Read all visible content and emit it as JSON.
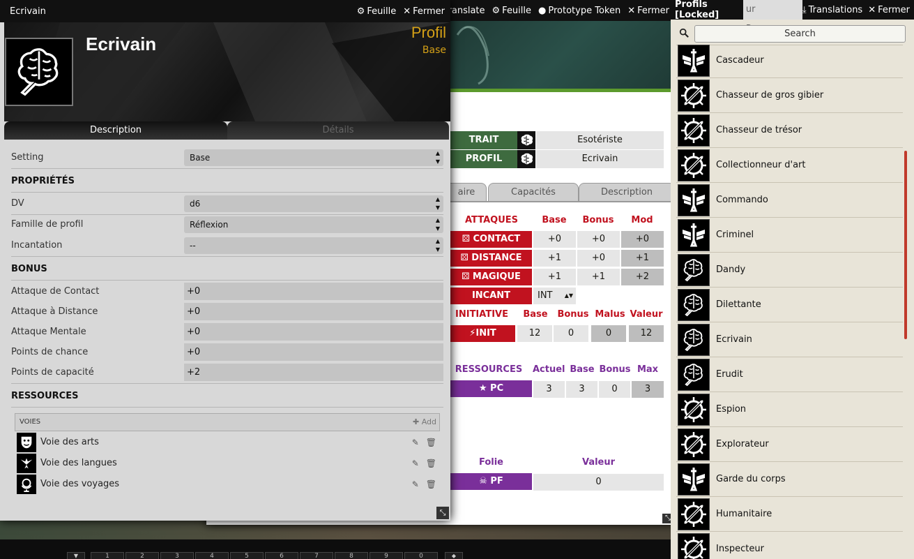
{
  "item_window": {
    "title": "Ecrivain",
    "sheet_label": "Feuille",
    "close_label": "Fermer",
    "name": "Ecrivain",
    "type_label": "Profil",
    "setting_value": "Base",
    "tabs": [
      "Description",
      "Détails"
    ],
    "fields": {
      "setting": {
        "label": "Setting",
        "value": "Base"
      },
      "proprietes_heading": "PROPRIÉTÉS",
      "dv": {
        "label": "DV",
        "value": "d6"
      },
      "famille": {
        "label": "Famille de profil",
        "value": "Réflexion"
      },
      "incantation": {
        "label": "Incantation",
        "value": "--"
      },
      "bonus_heading": "BONUS",
      "bonus": [
        {
          "label": "Attaque de Contact",
          "value": "+0"
        },
        {
          "label": "Attaque à Distance",
          "value": "+0"
        },
        {
          "label": "Attaque Mentale",
          "value": "+0"
        },
        {
          "label": "Points de chance",
          "value": "+0"
        },
        {
          "label": "Points de capacité",
          "value": "+2"
        }
      ],
      "ressources_heading": "RESSOURCES"
    },
    "voies": {
      "header": "VOIES",
      "add_label": "Add",
      "items": [
        {
          "name": "Voie des arts",
          "icon": "theater-mask-icon"
        },
        {
          "name": "Voie des langues",
          "icon": "bird-icon"
        },
        {
          "name": "Voie des voyages",
          "icon": "globe-icon"
        }
      ]
    }
  },
  "actor_window": {
    "header_buttons": [
      "Translate",
      "Feuille",
      "Prototype Token",
      "Fermer"
    ],
    "trait": {
      "label": "TRAIT",
      "value": "Esotériste"
    },
    "profil": {
      "label": "PROFIL",
      "value": "Ecrivain"
    },
    "tabs": [
      "aire",
      "Capacités",
      "Description"
    ],
    "attaques": {
      "heading": "ATTAQUES",
      "cols": [
        "Base",
        "Bonus",
        "Mod"
      ],
      "rows": [
        {
          "label": "CONTACT",
          "values": [
            "+0",
            "+0",
            "+0"
          ]
        },
        {
          "label": "DISTANCE",
          "values": [
            "+1",
            "+0",
            "+1"
          ]
        },
        {
          "label": "MAGIQUE",
          "values": [
            "+1",
            "+1",
            "+2"
          ]
        }
      ],
      "incant": {
        "label": "INCANT",
        "value": "INT"
      }
    },
    "initiative": {
      "heading": "INITIATIVE",
      "cols": [
        "Base",
        "Bonus",
        "Malus",
        "Valeur"
      ],
      "label": "INIT",
      "values": [
        "12",
        "0",
        "0",
        "12"
      ]
    },
    "ressources": {
      "heading": "RESSOURCES",
      "cols": [
        "Actuel",
        "Base",
        "Bonus",
        "Max"
      ],
      "label": "PC",
      "values": [
        "3",
        "3",
        "0",
        "3"
      ]
    },
    "folie": {
      "heading": "Folie",
      "col": "Valeur",
      "label": "PF",
      "value": "0"
    }
  },
  "compendium": {
    "title": "Profils [Locked]",
    "behind_tab": "ur Personnage",
    "translations_label": "Translations",
    "close_label": "Fermer",
    "search_placeholder": "Search",
    "entries": [
      {
        "name": "Cascadeur",
        "icon": "sword-wings-icon"
      },
      {
        "name": "Chasseur de gros gibier",
        "icon": "compass-crossed-icon"
      },
      {
        "name": "Chasseur de trésor",
        "icon": "compass-crossed-icon"
      },
      {
        "name": "Collectionneur d'art",
        "icon": "compass-crossed-icon"
      },
      {
        "name": "Commando",
        "icon": "sword-wings-icon"
      },
      {
        "name": "Criminel",
        "icon": "sword-wings-icon"
      },
      {
        "name": "Dandy",
        "icon": "brain-icon"
      },
      {
        "name": "Dilettante",
        "icon": "brain-icon"
      },
      {
        "name": "Ecrivain",
        "icon": "brain-icon"
      },
      {
        "name": "Erudit",
        "icon": "brain-icon"
      },
      {
        "name": "Espion",
        "icon": "compass-crossed-icon"
      },
      {
        "name": "Explorateur",
        "icon": "compass-crossed-icon"
      },
      {
        "name": "Garde du corps",
        "icon": "sword-wings-icon"
      },
      {
        "name": "Humanitaire",
        "icon": "compass-crossed-icon"
      },
      {
        "name": "Inspecteur",
        "icon": "compass-crossed-icon"
      }
    ]
  },
  "hotbar": {
    "slots": [
      "1",
      "2",
      "3",
      "4",
      "5",
      "6",
      "7",
      "8",
      "9",
      "0"
    ]
  }
}
